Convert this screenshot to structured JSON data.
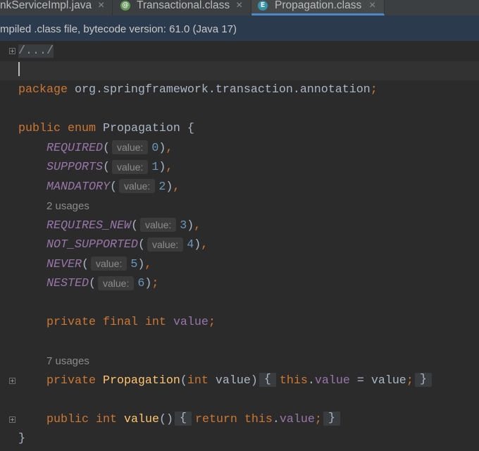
{
  "theme": {
    "tabbar-bg": "#3C3F41",
    "tab-active-bg": "#45494A",
    "tab-active-accent": "#4A88C7",
    "notice-bg": "#2B3A4C",
    "editor-bg": "#2B2B2B",
    "caret-line-bg": "#323232",
    "code-text": "#A9B7C6",
    "keyword": "#CC7832",
    "constant": "#9876AA",
    "number": "#6897BB",
    "method": "#FFC66D",
    "inlay-bg": "#3B3B3B",
    "inlay-text": "#8C8C8C",
    "annotation-icon-bg": "#629755",
    "enum-icon-bg": "#3592AA"
  },
  "tabs": [
    {
      "label": "nkServiceImpl.java",
      "close": "×",
      "active": false
    },
    {
      "icon": "annotation-icon",
      "icon_glyph": "@",
      "label": "Transactional.class",
      "close": "×",
      "active": false
    },
    {
      "icon": "enum-icon",
      "icon_glyph": "E",
      "label": "Propagation.class",
      "close": "×",
      "active": true
    }
  ],
  "notice": {
    "text": "mpiled .class file, bytecode version: 61.0 (Java 17)"
  },
  "editor": {
    "lines": [
      {
        "folded": true,
        "tokens": [
          {
            "folded_comment": "/.../"
          }
        ]
      },
      {
        "current": true,
        "tokens": []
      },
      {
        "tokens": [
          {
            "keyword": "package"
          },
          {
            "plain": " org.springframework.transaction.annotation"
          },
          {
            "punct": ";"
          }
        ]
      },
      {
        "tokens": []
      },
      {
        "tokens": [
          {
            "keyword": "public"
          },
          {
            "plain": " "
          },
          {
            "keyword": "enum"
          },
          {
            "plain": " Propagation {"
          }
        ]
      },
      {
        "tokens": [
          {
            "plain": "    "
          },
          {
            "constant": "REQUIRED"
          },
          {
            "plain": "("
          },
          {
            "hint": "value:"
          },
          {
            "number": "0"
          },
          {
            "plain": ")"
          },
          {
            "punct": ","
          }
        ]
      },
      {
        "tokens": [
          {
            "plain": "    "
          },
          {
            "constant": "SUPPORTS"
          },
          {
            "plain": "("
          },
          {
            "hint": "value:"
          },
          {
            "number": "1"
          },
          {
            "plain": ")"
          },
          {
            "punct": ","
          }
        ]
      },
      {
        "tokens": [
          {
            "plain": "    "
          },
          {
            "constant": "MANDATORY"
          },
          {
            "plain": "("
          },
          {
            "hint": "value:"
          },
          {
            "number": "2"
          },
          {
            "plain": ")"
          },
          {
            "punct": ","
          }
        ]
      },
      {
        "tokens": [
          {
            "plain": "    "
          },
          {
            "usages": "2 usages"
          }
        ]
      },
      {
        "tokens": [
          {
            "plain": "    "
          },
          {
            "constant": "REQUIRES_NEW"
          },
          {
            "plain": "("
          },
          {
            "hint": "value:"
          },
          {
            "number": "3"
          },
          {
            "plain": ")"
          },
          {
            "punct": ","
          }
        ]
      },
      {
        "tokens": [
          {
            "plain": "    "
          },
          {
            "constant": "NOT_SUPPORTED"
          },
          {
            "plain": "("
          },
          {
            "hint": "value:"
          },
          {
            "number": "4"
          },
          {
            "plain": ")"
          },
          {
            "punct": ","
          }
        ]
      },
      {
        "tokens": [
          {
            "plain": "    "
          },
          {
            "constant": "NEVER"
          },
          {
            "plain": "("
          },
          {
            "hint": "value:"
          },
          {
            "number": "5"
          },
          {
            "plain": ")"
          },
          {
            "punct": ","
          }
        ]
      },
      {
        "tokens": [
          {
            "plain": "    "
          },
          {
            "constant": "NESTED"
          },
          {
            "plain": "("
          },
          {
            "hint": "value:"
          },
          {
            "number": "6"
          },
          {
            "plain": ")"
          },
          {
            "punct": ";"
          }
        ]
      },
      {
        "tokens": []
      },
      {
        "tokens": [
          {
            "plain": "    "
          },
          {
            "keyword": "private"
          },
          {
            "plain": " "
          },
          {
            "keyword": "final"
          },
          {
            "plain": " "
          },
          {
            "keyword": "int"
          },
          {
            "plain": " "
          },
          {
            "field": "value"
          },
          {
            "punct": ";"
          }
        ]
      },
      {
        "tokens": []
      },
      {
        "tokens": [
          {
            "plain": "    "
          },
          {
            "usages": "7 usages"
          }
        ]
      },
      {
        "folded": true,
        "tokens": [
          {
            "plain": "    "
          },
          {
            "keyword": "private"
          },
          {
            "plain": " "
          },
          {
            "method": "Propagation"
          },
          {
            "plain": "("
          },
          {
            "keyword": "int"
          },
          {
            "plain": " value)"
          },
          {
            "fold": "{"
          },
          {
            "keyword": "this"
          },
          {
            "plain": "."
          },
          {
            "field": "value"
          },
          {
            "plain": " = value"
          },
          {
            "punct": ";"
          },
          {
            "fold": "}"
          }
        ]
      },
      {
        "tokens": []
      },
      {
        "folded": true,
        "tokens": [
          {
            "plain": "    "
          },
          {
            "keyword": "public"
          },
          {
            "plain": " "
          },
          {
            "keyword": "int"
          },
          {
            "plain": " "
          },
          {
            "method": "value"
          },
          {
            "plain": "()"
          },
          {
            "fold": "{"
          },
          {
            "keyword": "return"
          },
          {
            "plain": " "
          },
          {
            "keyword": "this"
          },
          {
            "plain": "."
          },
          {
            "field": "value"
          },
          {
            "punct": ";"
          },
          {
            "fold": "}"
          }
        ]
      },
      {
        "tokens": [
          {
            "plain": "}"
          }
        ]
      }
    ]
  }
}
